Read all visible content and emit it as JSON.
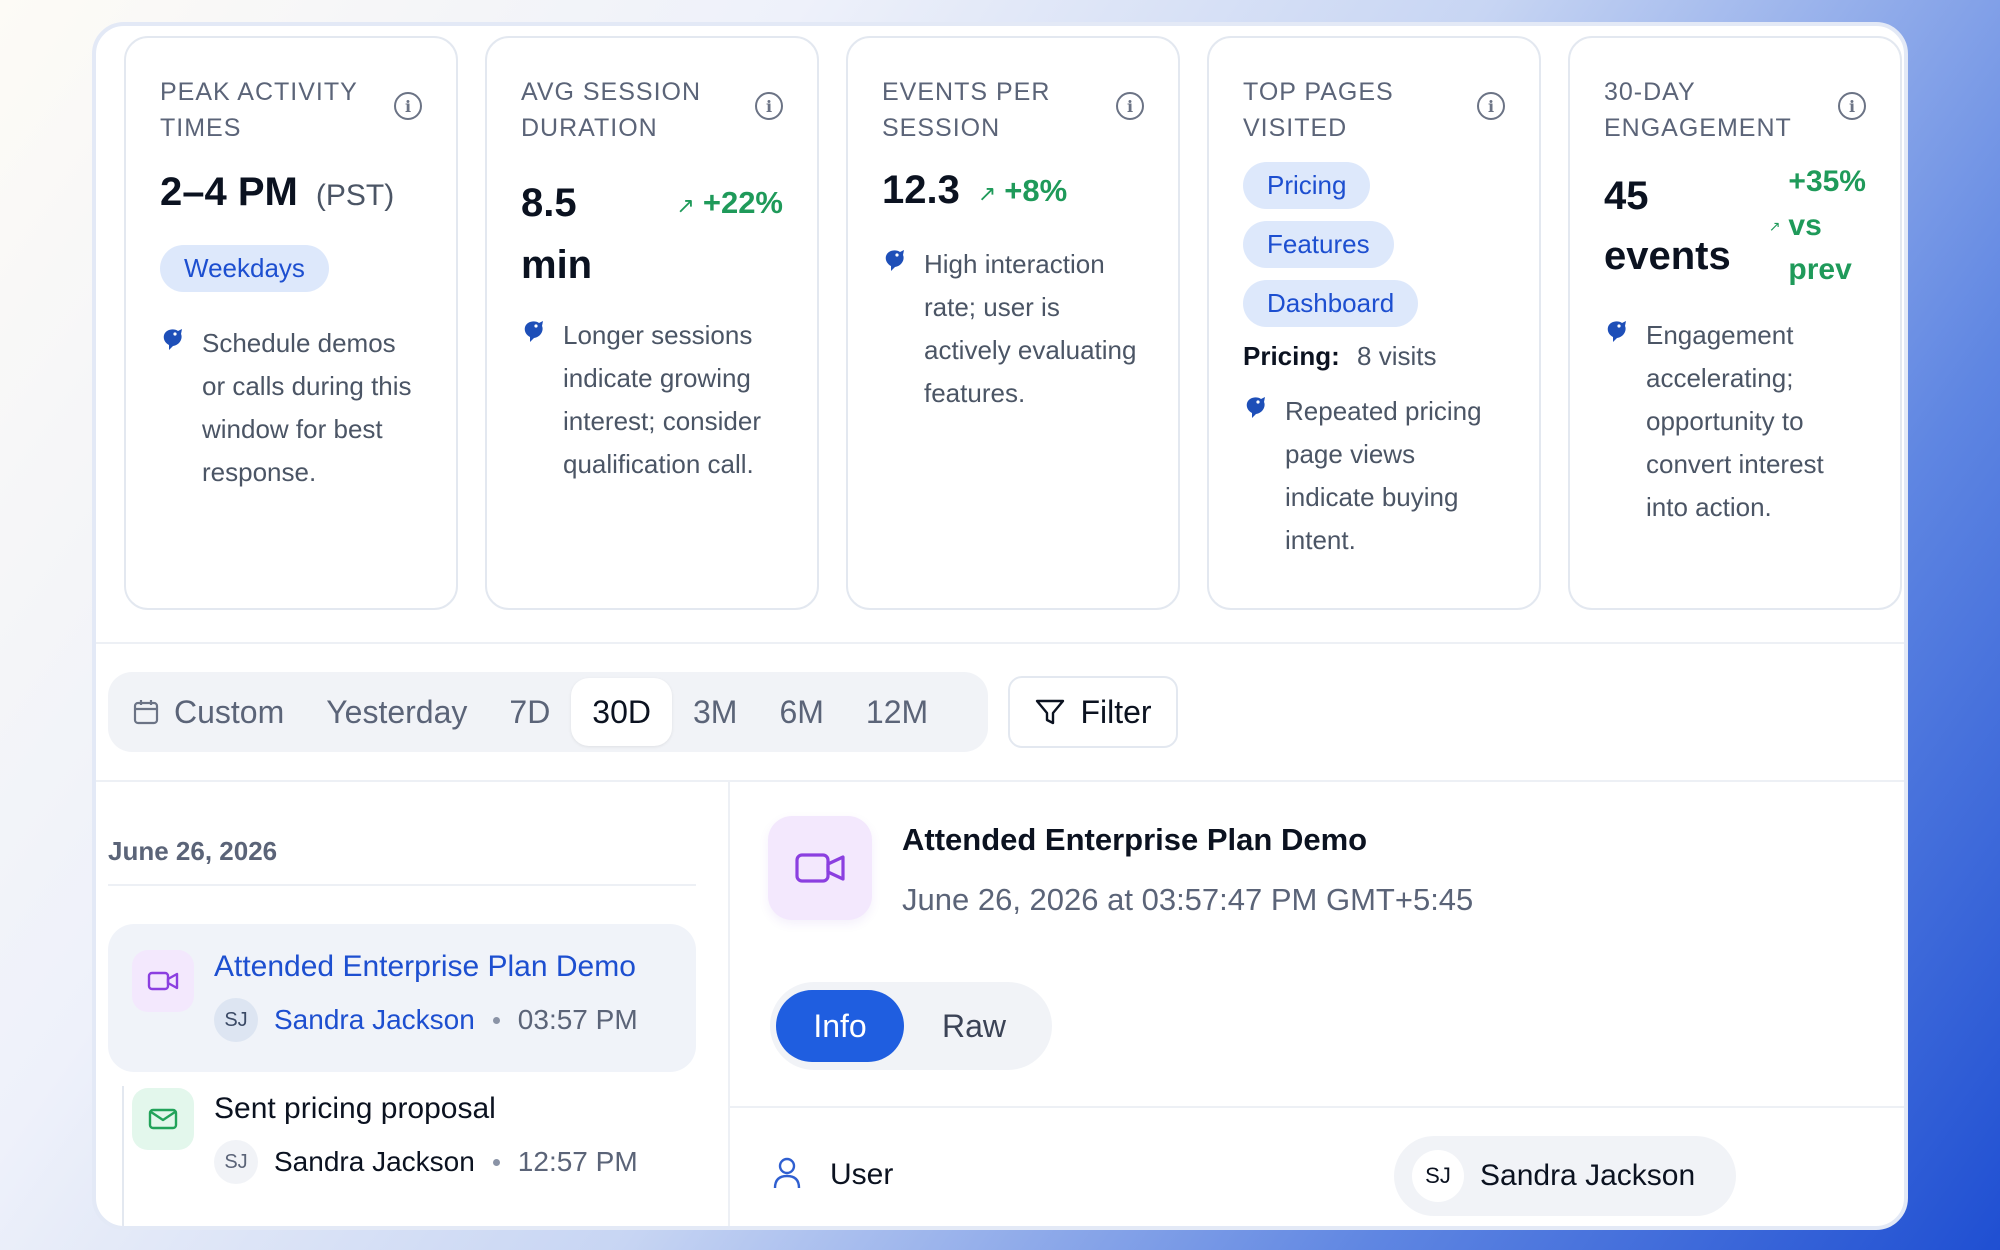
{
  "cards": [
    {
      "title": "Peak Activity Times",
      "value": "2–4 PM",
      "unit": "(PST)",
      "chip": "Weekdays",
      "insight": "Schedule demos or calls during this window for best response."
    },
    {
      "title": "Avg Session Duration",
      "value_line1": "8.5",
      "value_line2": "min",
      "delta": "+22%",
      "insight": "Longer sessions indicate growing interest; consider qualification call."
    },
    {
      "title": "Events Per Session",
      "value": "12.3",
      "delta": "+8%",
      "insight": "High interaction rate; user is actively evaluating features."
    },
    {
      "title": "Top Pages Visited",
      "chips": [
        "Pricing",
        "Features",
        "Dashboard"
      ],
      "stat_label": "Pricing:",
      "stat_value": "8 visits",
      "insight": "Repeated pricing page views indicate buying intent."
    },
    {
      "title": "30-Day Engagement",
      "value_line1": "45",
      "value_line2": "events",
      "delta_line1": "+35%",
      "delta_line2": "vs",
      "delta_line3": "prev",
      "insight": "Engagement accelerating; opportunity to convert interest into action."
    }
  ],
  "range": {
    "items": [
      "Custom",
      "Yesterday",
      "7D",
      "30D",
      "3M",
      "6M",
      "12M"
    ],
    "active": "30D"
  },
  "filter_label": "Filter",
  "timeline": {
    "date": "June 26, 2026",
    "events": [
      {
        "title": "Attended Enterprise Plan Demo",
        "initials": "SJ",
        "user": "Sandra Jackson",
        "time": "03:57 PM",
        "icon": "video-icon",
        "selected": true
      },
      {
        "title": "Sent pricing proposal",
        "initials": "SJ",
        "user": "Sandra Jackson",
        "time": "12:57 PM",
        "icon": "mail-icon",
        "selected": false
      }
    ]
  },
  "detail": {
    "title": "Attended Enterprise Plan Demo",
    "timestamp": "June 26, 2026 at 03:57:47 PM GMT+5:45",
    "tabs": [
      "Info",
      "Raw"
    ],
    "active_tab": "Info",
    "field_label": "User",
    "field_initials": "SJ",
    "field_value": "Sandra Jackson"
  },
  "colors": {
    "accent": "#1f5ee0",
    "positive": "#1f9a5a",
    "video_icon": "#8b3fe0",
    "mail_icon": "#22a35a"
  }
}
